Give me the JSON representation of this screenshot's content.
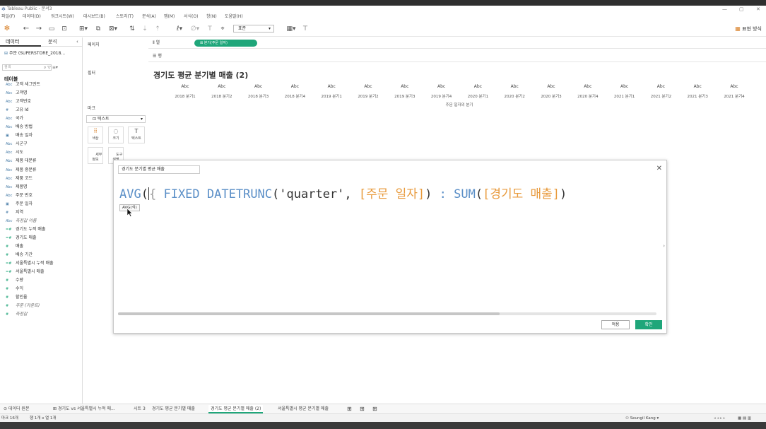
{
  "window": {
    "title": "Tableau Public - 문서3",
    "controls": [
      "—",
      "▢",
      "✕"
    ]
  },
  "menu": [
    "파일(F)",
    "데이터(D)",
    "워크시트(W)",
    "대시보드(B)",
    "스토리(T)",
    "분석(A)",
    "맵(M)",
    "서식(O)",
    "창(N)",
    "도움말(H)"
  ],
  "toolbar": {
    "fit": "표준",
    "presentation": "표현 방식"
  },
  "data_pane": {
    "tab_data": "데이터",
    "tab_analysis": "분석",
    "datasource": "주문 (SUPERSTORE_2018...",
    "search_placeholder": "검색",
    "tables_heading": "테이블",
    "fields": [
      {
        "type": "Abc",
        "name": "고객 세그먼트",
        "kind": "dim"
      },
      {
        "type": "Abc",
        "name": "고객명",
        "kind": "dim"
      },
      {
        "type": "Abc",
        "name": "고객번호",
        "kind": "dim"
      },
      {
        "type": "#",
        "name": "고유 Id",
        "kind": "dim"
      },
      {
        "type": "Abc",
        "name": "국가",
        "kind": "dim"
      },
      {
        "type": "Abc",
        "name": "배송 방법",
        "kind": "dim"
      },
      {
        "type": "▣",
        "name": "배송 일자",
        "kind": "dim"
      },
      {
        "type": "Abc",
        "name": "시군구",
        "kind": "dim"
      },
      {
        "type": "Abc",
        "name": "시도",
        "kind": "dim"
      },
      {
        "type": "Abc",
        "name": "제품 대분류",
        "kind": "dim"
      },
      {
        "type": "Abc",
        "name": "제품 중분류",
        "kind": "dim"
      },
      {
        "type": "Abc",
        "name": "제품 코드",
        "kind": "dim"
      },
      {
        "type": "Abc",
        "name": "제품명",
        "kind": "dim"
      },
      {
        "type": "Abc",
        "name": "주문 번호",
        "kind": "dim"
      },
      {
        "type": "▣",
        "name": "주문 일자",
        "kind": "dim"
      },
      {
        "type": "#",
        "name": "지역",
        "kind": "dim"
      },
      {
        "type": "Abc",
        "name": "측정값 이름",
        "kind": "dim",
        "italic": true
      },
      {
        "type": "=#",
        "name": "경기도 누적 매출",
        "kind": "meas"
      },
      {
        "type": "=#",
        "name": "경기도 매출",
        "kind": "meas"
      },
      {
        "type": "#",
        "name": "매출",
        "kind": "meas"
      },
      {
        "type": "#",
        "name": "배송 기간",
        "kind": "meas"
      },
      {
        "type": "=#",
        "name": "서울특별시 누적 매출",
        "kind": "meas"
      },
      {
        "type": "=#",
        "name": "서울특별시 매출",
        "kind": "meas"
      },
      {
        "type": "#",
        "name": "수량",
        "kind": "meas"
      },
      {
        "type": "#",
        "name": "수익",
        "kind": "meas"
      },
      {
        "type": "#",
        "name": "할인율",
        "kind": "meas"
      },
      {
        "type": "#",
        "name": "주문 (카운트)",
        "kind": "meas",
        "italic": true
      },
      {
        "type": "#",
        "name": "측정값",
        "kind": "meas",
        "italic": true
      }
    ]
  },
  "shelves": {
    "pages": "페이지",
    "filters": "필터",
    "marks": "마크",
    "marks_type": "텍스트",
    "columns": "열",
    "rows": "행",
    "column_pill": "분기(주문 일자)",
    "mark_buttons": [
      {
        "icon": "⠿",
        "label": "색상"
      },
      {
        "icon": "◌",
        "label": "크기"
      },
      {
        "icon": "T",
        "label": "텍스트"
      },
      {
        "icon": "",
        "label": "세부\n정보"
      },
      {
        "icon": "",
        "label": "도구\n설명"
      }
    ]
  },
  "viz": {
    "title": "경기도 평균 분기별 매출 (2)",
    "cell_text": "Abc",
    "quarters": [
      "2018 분기1",
      "2018 분기2",
      "2018 분기3",
      "2018 분기4",
      "2019 분기1",
      "2019 분기2",
      "2019 분기3",
      "2019 분기4",
      "2020 분기1",
      "2020 분기2",
      "2020 분기3",
      "2020 분기4",
      "2021 분기1",
      "2021 분기2",
      "2021 분기3",
      "2021 분기4"
    ],
    "axis_caption": "주문 일자의 분기"
  },
  "dialog": {
    "calc_name": "경기도 분기별 평균 매출",
    "formula": {
      "avg": "AVG",
      "open": "(",
      "brace_open": "{",
      "fixed": "FIXED",
      "datetrunc": "DATETRUNC",
      "args_open": "(",
      "quarter": "'quarter'",
      "comma": ", ",
      "field1": "[주문 일자]",
      "args_close": ")",
      "colon": " : ",
      "sum": "SUM",
      "sum_open": "(",
      "field2": "[경기도 매출]",
      "close": ")"
    },
    "tooltip": "AVG(식)",
    "apply": "적용",
    "ok": "확인"
  },
  "sheet_tabs": [
    "데이터 원본",
    "경기도 vs 서울특별시 누적 매...",
    "시트 3",
    "경기도 평균 분기별 매출",
    "경기도 평균 분기별 매출 (2)",
    "서울특별시 평균 분기별 매출"
  ],
  "status": {
    "marks": "마크 16개",
    "dims": "행 1개 x 열 1개",
    "user": "Seungil Kang"
  }
}
